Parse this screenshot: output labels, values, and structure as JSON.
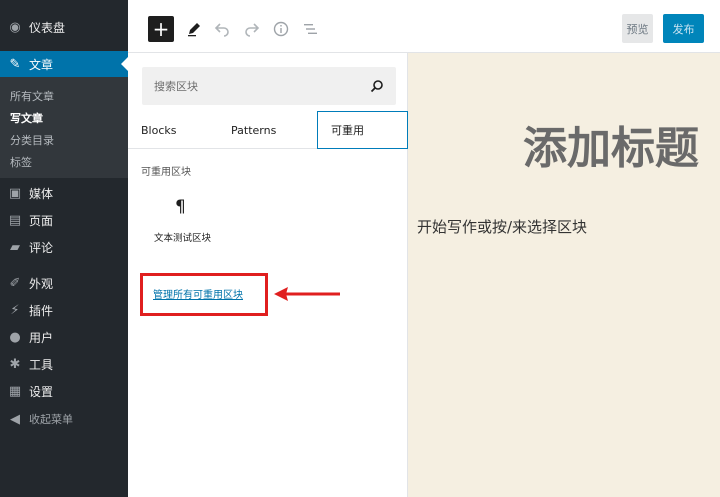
{
  "sidebar": {
    "dashboard": "仪表盘",
    "posts": "文章",
    "posts_sub": [
      "所有文章",
      "写文章",
      "分类目录",
      "标签"
    ],
    "media": "媒体",
    "pages": "页面",
    "comments": "评论",
    "appearance": "外观",
    "plugins": "插件",
    "users": "用户",
    "tools": "工具",
    "settings": "设置",
    "collapse": "收起菜单"
  },
  "toolbar": {
    "add_label": "+",
    "preview_label": "预览",
    "publish_label": "发布"
  },
  "inserter": {
    "search_placeholder": "搜索区块",
    "tabs": [
      "Blocks",
      "Patterns",
      "可重用"
    ],
    "section_title": "可重用区块",
    "block_icon": "¶",
    "block_label": "文本测试区块",
    "manage_link": "管理所有可重用区块"
  },
  "editor": {
    "title_placeholder": "添加标题",
    "body_placeholder": "开始写作或按/来选择区块"
  },
  "colors": {
    "admin_bg": "#23282d",
    "accent": "#0073aa",
    "canvas_bg": "#f5efe1",
    "highlight": "#e01f1f"
  }
}
